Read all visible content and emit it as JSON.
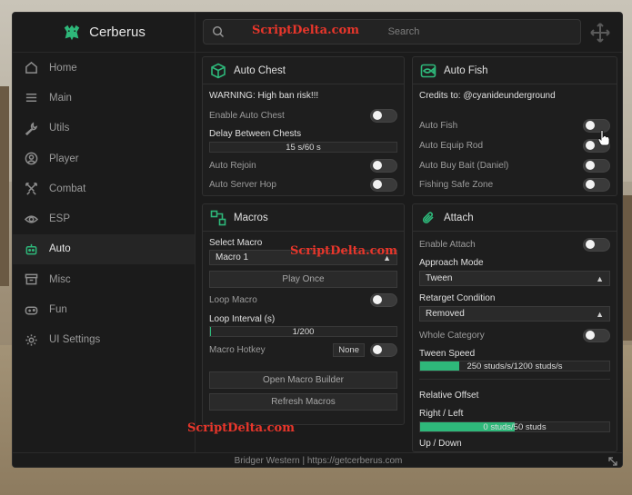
{
  "app": {
    "name": "Cerberus",
    "footer": "Bridger Western | https://getcerberus.com"
  },
  "search": {
    "placeholder": "Search"
  },
  "watermarks": [
    "ScriptDelta.com",
    "ScriptDelta.com",
    "ScriptDelta.com"
  ],
  "sidebar": {
    "items": [
      {
        "label": "Home",
        "icon": "home-icon",
        "active": false
      },
      {
        "label": "Main",
        "icon": "menu-icon",
        "active": false
      },
      {
        "label": "Utils",
        "icon": "wrench-icon",
        "active": false
      },
      {
        "label": "Player",
        "icon": "user-icon",
        "active": false
      },
      {
        "label": "Combat",
        "icon": "swords-icon",
        "active": false
      },
      {
        "label": "ESP",
        "icon": "eye-icon",
        "active": false
      },
      {
        "label": "Auto",
        "icon": "robot-icon",
        "active": true
      },
      {
        "label": "Misc",
        "icon": "archive-icon",
        "active": false
      },
      {
        "label": "Fun",
        "icon": "gamepad-icon",
        "active": false
      },
      {
        "label": "UI Settings",
        "icon": "gear-icon",
        "active": false
      }
    ]
  },
  "auto_chest": {
    "title": "Auto Chest",
    "warning": "WARNING: High ban risk!!!",
    "enable_label": "Enable Auto Chest",
    "delay_label": "Delay Between Chests",
    "delay_value": "15 s/60 s",
    "delay_fraction": 0.25,
    "rejoin_label": "Auto Rejoin",
    "hop_label": "Auto Server Hop"
  },
  "macros": {
    "title": "Macros",
    "select_label": "Select Macro",
    "selected": "Macro 1",
    "play_once": "Play Once",
    "loop_label": "Loop Macro",
    "interval_label": "Loop Interval (s)",
    "interval_value": "1/200",
    "interval_fraction": 0.005,
    "hotkey_label": "Macro Hotkey",
    "hotkey_value": "None",
    "builder_button": "Open Macro Builder",
    "refresh_button": "Refresh Macros"
  },
  "auto_fish": {
    "title": "Auto Fish",
    "credits": "Credits to: @cyanideunderground",
    "fish_label": "Auto Fish",
    "equip_label": "Auto Equip Rod",
    "bait_label": "Auto Buy Bait (Daniel)",
    "safe_label": "Fishing Safe Zone"
  },
  "attach": {
    "title": "Attach",
    "enable_label": "Enable Attach",
    "approach_label": "Approach Mode",
    "approach_value": "Tween",
    "retarget_label": "Retarget Condition",
    "retarget_value": "Removed",
    "whole_label": "Whole Category",
    "speed_label": "Tween Speed",
    "speed_value": "250 studs/s/1200 studs/s",
    "speed_fraction": 0.208,
    "offset_label": "Relative Offset",
    "rl_label": "Right / Left",
    "rl_value": "0 studs/50 studs",
    "updown_label": "Up / Down"
  },
  "colors": {
    "accent": "#2eb87a",
    "watermark": "#e8362b"
  }
}
